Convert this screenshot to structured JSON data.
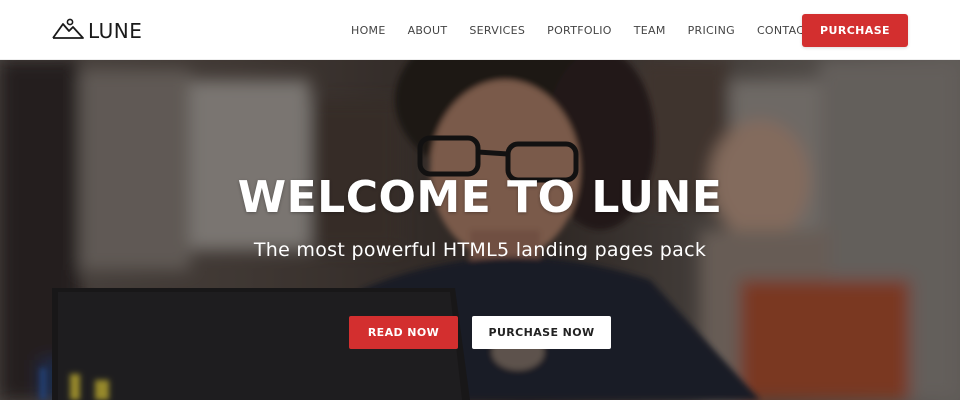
{
  "brand": {
    "name": "LUNE",
    "logo_icon": "mountain-icon"
  },
  "nav": {
    "items": [
      {
        "label": "HOME"
      },
      {
        "label": "ABOUT"
      },
      {
        "label": "SERVICES"
      },
      {
        "label": "PORTFOLIO"
      },
      {
        "label": "TEAM"
      },
      {
        "label": "PRICING"
      },
      {
        "label": "CONTACT"
      }
    ],
    "purchase_label": "PURCHASE"
  },
  "hero": {
    "title": "WELCOME TO LUNE",
    "subtitle": "The most powerful HTML5 landing pages pack",
    "primary_button": "READ NOW",
    "secondary_button": "PURCHASE NOW"
  },
  "colors": {
    "accent": "#d32f2f",
    "header_bg": "#ffffff",
    "hero_text": "#ffffff"
  }
}
